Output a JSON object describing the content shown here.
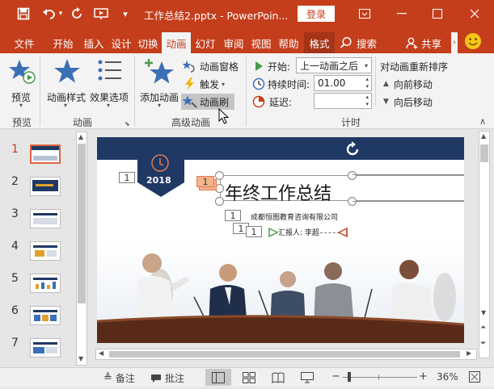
{
  "window": {
    "title": "工作总结2.pptx - PowerPoin...",
    "login_label": "登录"
  },
  "tabs": [
    {
      "label": "文件"
    },
    {
      "label": "开始"
    },
    {
      "label": "插入"
    },
    {
      "label": "设计"
    },
    {
      "label": "切换"
    },
    {
      "label": "动画"
    },
    {
      "label": "幻灯"
    },
    {
      "label": "审阅"
    },
    {
      "label": "视图"
    },
    {
      "label": "帮助"
    },
    {
      "label": "格式"
    }
  ],
  "search_label": "搜索",
  "share_label": "共享",
  "ribbon": {
    "preview": {
      "button": "预览",
      "group": "预览"
    },
    "animation": {
      "style_button": "动画样式",
      "effects_button": "效果选项",
      "group": "动画"
    },
    "advanced": {
      "add_button": "添加动画",
      "pane_button": "动画窗格",
      "trigger_button": "触发",
      "painter_button": "动画刷",
      "group": "高级动画"
    },
    "timing": {
      "start_label": "开始:",
      "start_value": "上一动画之后",
      "duration_label": "持续时间:",
      "duration_value": "01.00",
      "delay_label": "延迟:",
      "delay_value": "",
      "group": "计时",
      "reorder_title": "对动画重新排序",
      "move_earlier": "向前移动",
      "move_later": "向后移动"
    }
  },
  "slides": [
    {
      "num": "1"
    },
    {
      "num": "2"
    },
    {
      "num": "3"
    },
    {
      "num": "4"
    },
    {
      "num": "5"
    },
    {
      "num": "6"
    },
    {
      "num": "7"
    }
  ],
  "slide": {
    "year": "2018",
    "title": "年终工作总结",
    "company": "成都恒图教育咨询有限公司",
    "reporter": "汇报人: 李超",
    "anim_numbers": [
      "1",
      "1",
      "1",
      "1",
      "1"
    ]
  },
  "status": {
    "notes_label": "备注",
    "comments_label": "批注",
    "zoom": "36%"
  },
  "colors": {
    "accent": "#c43e1c",
    "slide_banner": "#1f3864"
  }
}
